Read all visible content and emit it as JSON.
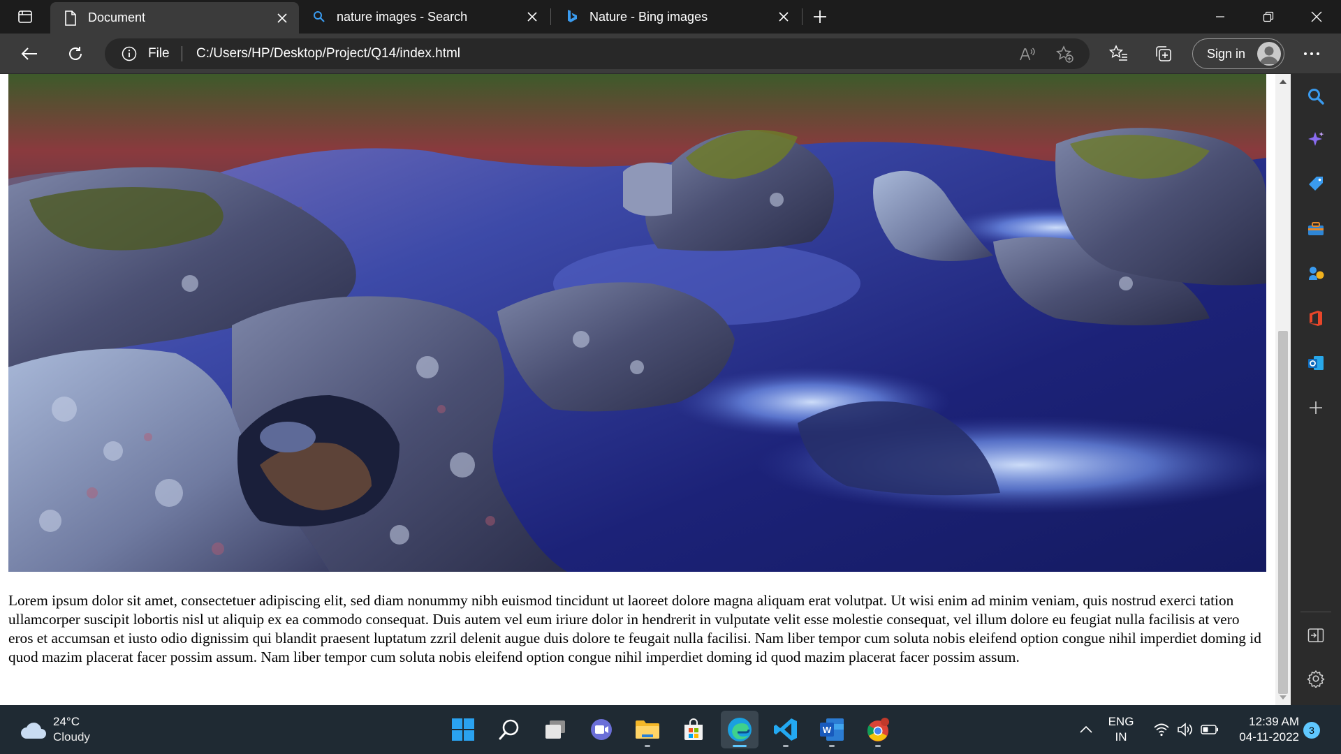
{
  "browser": {
    "tabs": [
      {
        "label": "Document",
        "icon": "document-icon",
        "active": true
      },
      {
        "label": "nature images - Search",
        "icon": "search-icon",
        "active": false
      },
      {
        "label": "Nature - Bing images",
        "icon": "bing-icon",
        "active": false
      }
    ],
    "address": {
      "scheme": "File",
      "url": "C:/Users/HP/Desktop/Project/Q14/index.html"
    },
    "signin_label": "Sign in"
  },
  "page": {
    "paragraph": "Lorem ipsum dolor sit amet, consectetuer adipiscing elit, sed diam nonummy nibh euismod tincidunt ut laoreet dolore magna aliquam erat volutpat. Ut wisi enim ad minim veniam, quis nostrud exerci tation ullamcorper suscipit lobortis nisl ut aliquip ex ea commodo consequat. Duis autem vel eum iriure dolor in hendrerit in vulputate velit esse molestie consequat, vel illum dolore eu feugiat nulla facilisis at vero eros et accumsan et iusto odio dignissim qui blandit praesent luptatum zzril delenit augue duis dolore te feugait nulla facilisi. Nam liber tempor cum soluta nobis eleifend option congue nihil imperdiet doming id quod mazim placerat facer possim assum. Nam liber tempor cum soluta nobis eleifend option congue nihil imperdiet doming id quod mazim placerat facer possim assum."
  },
  "sidebar": {
    "items": [
      "search-icon",
      "copilot-icon",
      "shopping-tag-icon",
      "toolbox-icon",
      "games-icon",
      "office-icon",
      "outlook-icon",
      "add-icon"
    ],
    "bottom": [
      "split-screen-icon",
      "settings-icon"
    ]
  },
  "taskbar": {
    "weather": {
      "temp": "24°C",
      "condition": "Cloudy"
    },
    "apps": [
      "start-icon",
      "search-icon",
      "task-view-icon",
      "chat-icon",
      "file-explorer-icon",
      "store-icon",
      "edge-icon",
      "vscode-icon",
      "word-icon",
      "chrome-icon"
    ],
    "lang": {
      "line1": "ENG",
      "line2": "IN"
    },
    "clock": {
      "time": "12:39 AM",
      "date": "04-11-2022"
    },
    "notification_count": "3"
  },
  "colors": {
    "accent": "#5fc8ff",
    "tab_active": "#3b3b3b",
    "titlebar": "#1c1c1c"
  }
}
